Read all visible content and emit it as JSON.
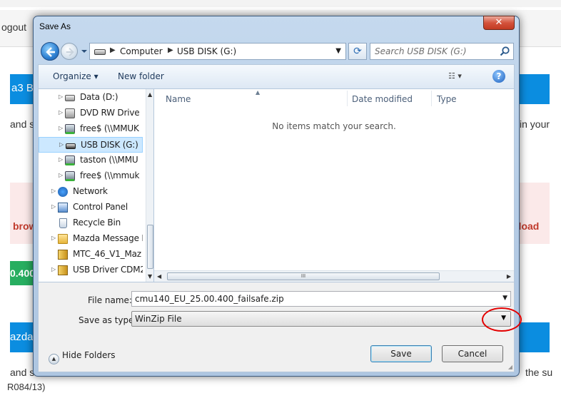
{
  "background_page": {
    "logout": "ogout",
    "heading_fragment": "a3 B",
    "text_left_1": "and s",
    "text_right_1": "in your",
    "red_left": "brow",
    "red_right": "nload",
    "green_badge": "0.400",
    "heading2_fragment": "azda",
    "text_left_2": "and s",
    "text_right_2": "the su",
    "footer_fragment": "R084/13)"
  },
  "dialog": {
    "title": "Save As",
    "close_label": "✕"
  },
  "address_bar": {
    "segments": [
      "Computer",
      "USB DISK (G:)"
    ],
    "separator": "▶"
  },
  "search": {
    "placeholder": "Search USB DISK (G:)"
  },
  "toolbar": {
    "organize_label": "Organize ▾",
    "new_folder_label": "New folder",
    "view_label": "☷ ▾",
    "help_label": "?"
  },
  "nav_tree": {
    "items": [
      {
        "label": "Data (D:)",
        "icon": "drive-icon"
      },
      {
        "label": "DVD RW Drive (",
        "icon": "dvd-drive-icon"
      },
      {
        "label": "free$ (\\\\MMUK",
        "icon": "network-drive-icon"
      },
      {
        "label": "USB DISK (G:)",
        "icon": "usb-drive-icon",
        "selected": true
      },
      {
        "label": "taston (\\\\MMU",
        "icon": "network-drive-icon"
      },
      {
        "label": "free$ (\\\\mmuk",
        "icon": "network-drive-icon"
      },
      {
        "label": "Network",
        "icon": "network-icon"
      },
      {
        "label": "Control Panel",
        "icon": "control-panel-icon"
      },
      {
        "label": "Recycle Bin",
        "icon": "recycle-bin-icon"
      },
      {
        "label": "Mazda Message I",
        "icon": "folder-icon"
      },
      {
        "label": "MTC_46_V1_Maz",
        "icon": "archive-icon"
      },
      {
        "label": "USB Driver CDM2",
        "icon": "archive-icon"
      }
    ]
  },
  "file_list": {
    "columns": [
      "Name",
      "Date modified",
      "Type"
    ],
    "empty_message": "No items match your search.",
    "scroll_grip": "III"
  },
  "form": {
    "file_name_label": "File name:",
    "file_name_value": "cmu140_EU_25.00.400_failsafe.zip",
    "save_as_type_label": "Save as type:",
    "save_as_type_value": "WinZip File"
  },
  "footer": {
    "hide_folders_label": "Hide Folders",
    "save_label": "Save",
    "cancel_label": "Cancel"
  },
  "colors": {
    "annotation": "#e30000",
    "selection": "#cce8ff",
    "close_button": "#c94a33"
  }
}
